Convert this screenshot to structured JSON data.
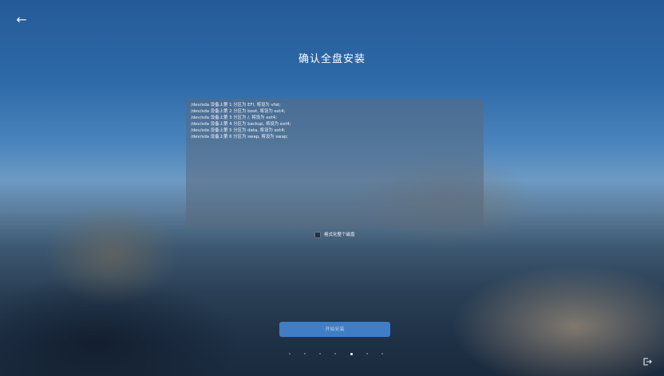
{
  "nav": {
    "back_glyph": "←",
    "back_icon": "arrow-left-icon",
    "exit_icon": "exit-icon"
  },
  "page": {
    "title": "确认全盘安装"
  },
  "partition_lines": [
    "/dev/sda 设备上第 1 分区为 EFI, 将设为 vfat;",
    "/dev/sda 设备上第 2 分区为 boot, 将设为 ext4;",
    "/dev/sda 设备上第 3 分区为 /, 将设为 ext4;",
    "/dev/sda 设备上第 4 分区为 backup, 将设为 ext4;",
    "/dev/sda 设备上第 5 分区为 data, 将设为 ext4;",
    "/dev/sda 设备上第 6 分区为 swap, 将设为 swap;"
  ],
  "format_option": {
    "label": "格式化整个磁盘",
    "checked": false
  },
  "actions": {
    "start_install": "开始安装"
  },
  "pager": {
    "count": 7,
    "active_index": 4
  },
  "colors": {
    "button": "#3f7dc6",
    "panel": "#5a697d"
  }
}
